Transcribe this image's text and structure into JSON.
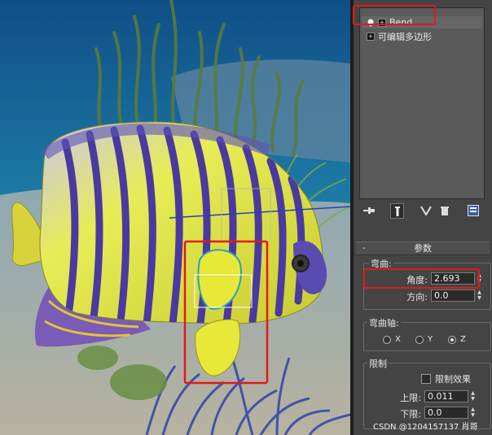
{
  "modifier_stack": {
    "items": [
      {
        "label": "Bend"
      },
      {
        "label": "可编辑多边形"
      }
    ]
  },
  "parameters": {
    "rollout_title": "参数",
    "bend_group": {
      "title": "弯曲:",
      "angle_label": "角度:",
      "angle_value": "2.693",
      "direction_label": "方向:",
      "direction_value": "0.0"
    },
    "axis_group": {
      "title": "弯曲轴:",
      "options": [
        "X",
        "Y",
        "Z"
      ],
      "selected": "Z"
    },
    "limits_group": {
      "title": "限制",
      "limit_effect_label": "限制效果",
      "limit_effect_checked": false,
      "upper_label": "上限:",
      "upper_value": "0.011",
      "lower_label": "下限:",
      "lower_value": "0.0"
    }
  },
  "watermark": "CSDN @1204157137 肖哥",
  "colors": {
    "highlight": "#e01a1a",
    "fish_body": "#e0e43a",
    "fish_stripe": "#4a3aa0",
    "ocean": "#1b6f9e"
  },
  "icons": [
    "lightbulb-icon",
    "pin-stack-icon",
    "show-end-result-icon",
    "make-unique-icon",
    "remove-modifier-icon",
    "configure-sets-icon"
  ]
}
